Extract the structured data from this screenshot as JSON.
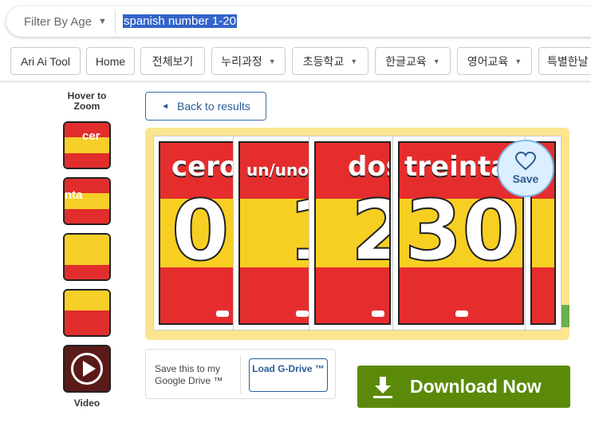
{
  "search": {
    "filter_label": "Filter By Age",
    "query": "spanish number 1-20"
  },
  "nav": {
    "chips": [
      {
        "label": "Ari Ai Tool"
      },
      {
        "label": "Home"
      },
      {
        "label": "전체보기"
      },
      {
        "label": "누리과정"
      },
      {
        "label": "초등학교"
      },
      {
        "label": "한글교육"
      },
      {
        "label": "영어교육"
      },
      {
        "label": "특별한날"
      }
    ]
  },
  "thumbnails": {
    "hover_label": "Hover to Zoom",
    "items": [
      {
        "text": "cer"
      },
      {
        "text": "nta"
      },
      {
        "text": ""
      },
      {
        "text": ""
      }
    ],
    "video_label": "Video"
  },
  "back_button": {
    "label": "Back to results"
  },
  "preview": {
    "cards": [
      {
        "word": "cero",
        "number": "0"
      },
      {
        "word": "un/uno",
        "number": "1"
      },
      {
        "word": "dos",
        "number": "2"
      },
      {
        "word": "treinta",
        "number": "30"
      }
    ],
    "save_label": "Save"
  },
  "drive": {
    "text": "Save this to my Google Drive ™",
    "button_label": "Load G-Drive ™"
  },
  "download": {
    "label": "Download Now"
  },
  "colors": {
    "red": "#e52d2d",
    "yellow": "#f7cf23",
    "download_green": "#5b8a0a",
    "link_blue": "#2a5d99"
  }
}
